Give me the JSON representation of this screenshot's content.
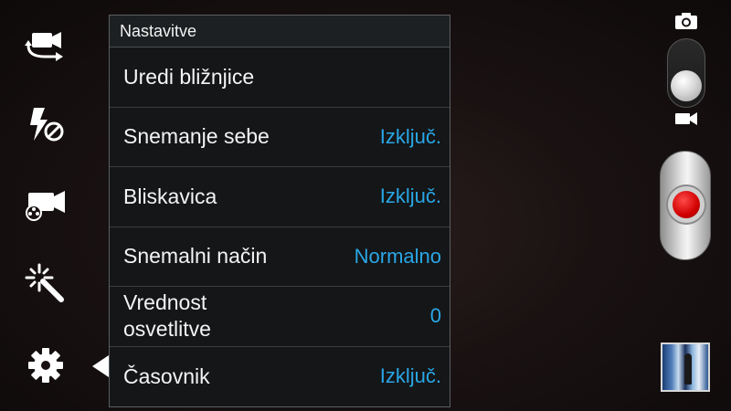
{
  "panel": {
    "title": "Nastavitve",
    "items": [
      {
        "label": "Uredi bližnjice",
        "value": ""
      },
      {
        "label": "Snemanje sebe",
        "value": "Izključ."
      },
      {
        "label": "Bliskavica",
        "value": "Izključ."
      },
      {
        "label": "Snemalni način",
        "value": "Normalno"
      },
      {
        "label_line1": "Vrednost",
        "label_line2": "osvetlitve",
        "value": "0"
      },
      {
        "label": "Časovnik",
        "value": "Izključ."
      }
    ]
  },
  "left_toolbar": [
    "switch-camera-icon",
    "flash-off-icon",
    "recording-mode-icon",
    "effects-wand-icon",
    "settings-gear-icon"
  ],
  "right_toolbar": [
    "camera-mode-icon",
    "video-mode-icon"
  ],
  "colors": {
    "value_accent": "#2aa7e6",
    "panel_bg": "#141618",
    "record": "#d10000"
  }
}
